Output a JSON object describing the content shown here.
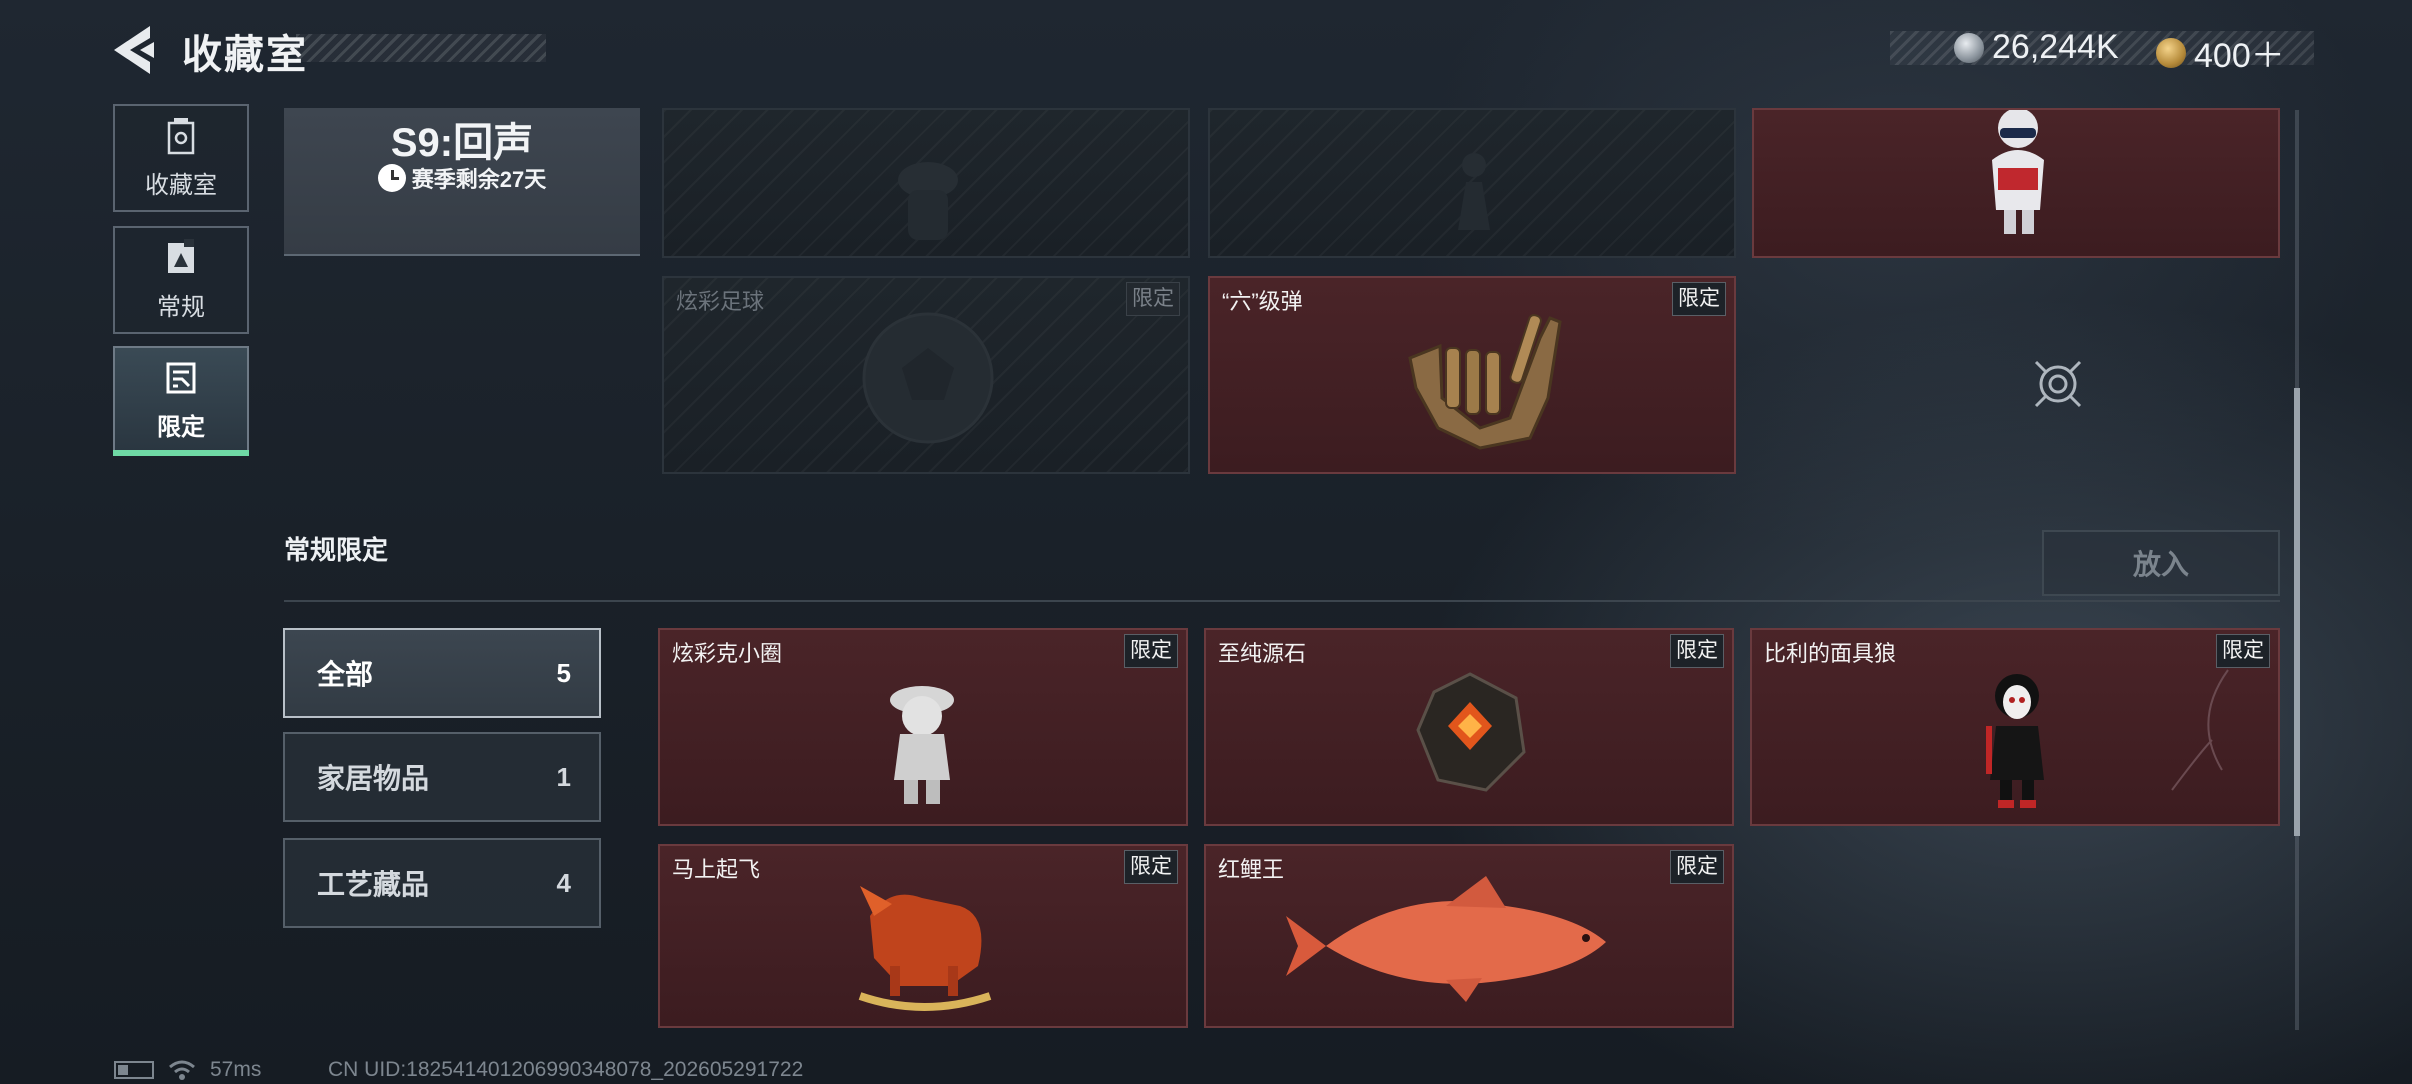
{
  "header": {
    "title": "收藏室",
    "currencies": [
      {
        "icon": "silver-coin-icon",
        "value": "26,244K"
      },
      {
        "icon": "gold-coin-icon",
        "value": "400＋"
      }
    ]
  },
  "nav": [
    {
      "label": "收藏室",
      "icon": "collection-icon",
      "active": false
    },
    {
      "label": "常规",
      "icon": "regular-icon",
      "active": false
    },
    {
      "label": "限定",
      "icon": "limited-icon",
      "active": true
    }
  ],
  "season": {
    "title": "S9:回声",
    "remaining": "赛季剩余27天"
  },
  "season_items": [
    {
      "name": "",
      "tag": "",
      "locked": true,
      "icon": "figure-silhouette-icon"
    },
    {
      "name": "",
      "tag": "",
      "locked": true,
      "icon": "chess-silhouette-icon"
    },
    {
      "name": "",
      "tag": "",
      "locked": false,
      "icon": "robot-figure-icon"
    },
    {
      "name": "炫彩足球",
      "tag": "限定",
      "locked": true,
      "icon": "football-icon"
    },
    {
      "name": "“六”级弹",
      "tag": "限定",
      "locked": false,
      "icon": "bullet-hand-icon"
    }
  ],
  "section": {
    "title": "常规限定",
    "put_button": "放入"
  },
  "filters": [
    {
      "label": "全部",
      "count": "5",
      "active": true
    },
    {
      "label": "家居物品",
      "count": "1",
      "active": false
    },
    {
      "label": "工艺藏品",
      "count": "4",
      "active": false
    }
  ],
  "regular_items": [
    {
      "name": "炫彩克小圈",
      "tag": "限定",
      "icon": "skeleton-figure-icon"
    },
    {
      "name": "至纯源石",
      "tag": "限定",
      "icon": "source-stone-icon"
    },
    {
      "name": "比利的面具狼",
      "tag": "限定",
      "icon": "puppet-figure-icon"
    },
    {
      "name": "马上起飞",
      "tag": "限定",
      "icon": "rocking-horse-icon"
    },
    {
      "name": "红鲤王",
      "tag": "限定",
      "icon": "red-carp-icon"
    }
  ],
  "footer": {
    "ping": "57ms",
    "uid": "CN UID:18254140120699034807​8_202605291722"
  },
  "colors": {
    "accent_green": "#6fd9a5",
    "card_red": "#4a2428",
    "locked_card": "#1f262c"
  }
}
